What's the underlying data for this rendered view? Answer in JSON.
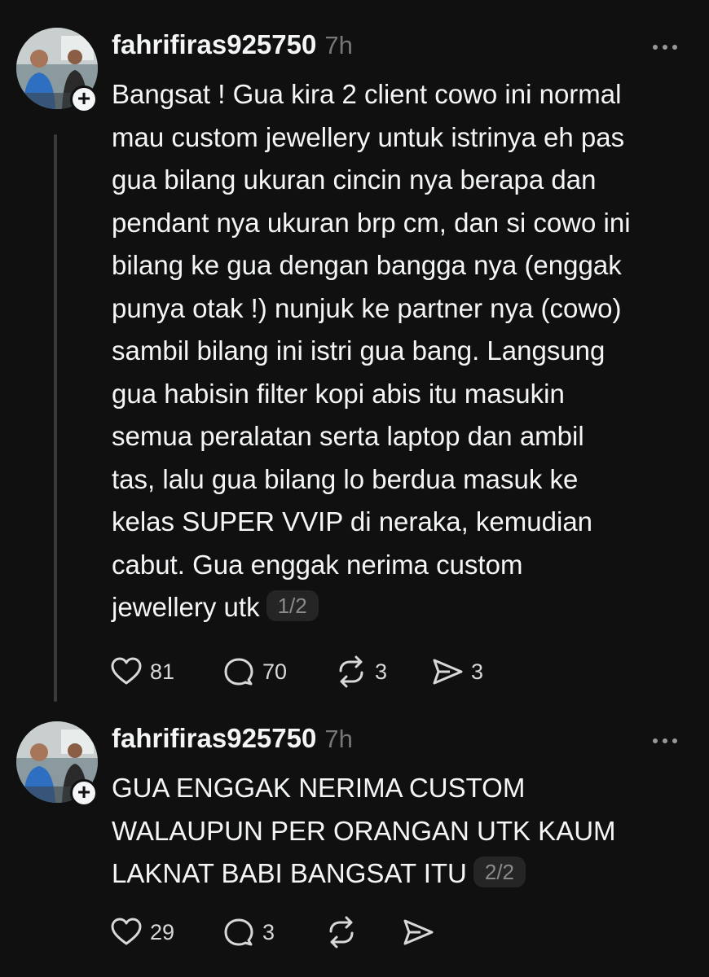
{
  "posts": [
    {
      "username": "fahrifiras925750",
      "time": "7h",
      "lines": [
        "Bangsat ! Gua kira 2 client cowo ini normal",
        "mau custom jewellery untuk istrinya eh pas",
        "gua bilang ukuran cincin nya berapa dan",
        "pendant nya ukuran brp cm, dan si cowo ini",
        "bilang ke gua dengan bangga nya (enggak",
        "punya otak !) nunjuk ke partner nya (cowo)",
        "sambil bilang ini istri gua bang. Langsung",
        "gua habisin filter kopi abis itu masukin",
        "semua peralatan serta laptop dan ambil",
        "tas, lalu gua bilang lo berdua masuk ke",
        "kelas SUPER VVIP di neraka, kemudian",
        "cabut. Gua enggak nerima custom",
        "jewellery utk"
      ],
      "page_indicator": "1/2",
      "likes": "81",
      "replies": "70",
      "reposts": "3",
      "shares": "3",
      "icons": [
        "heart-icon",
        "comment-icon",
        "repost-icon",
        "share-icon",
        "more-icon",
        "follow-plus-icon"
      ]
    },
    {
      "username": "fahrifiras925750",
      "time": "7h",
      "lines": [
        "GUA ENGGAK NERIMA CUSTOM",
        "WALAUPUN PER ORANGAN UTK KAUM",
        "LAKNAT BABI BANGSAT ITU"
      ],
      "page_indicator": "2/2",
      "likes": "29",
      "replies": "3",
      "reposts": "",
      "shares": "",
      "icons": [
        "heart-icon",
        "comment-icon",
        "repost-icon",
        "share-icon",
        "more-icon",
        "follow-plus-icon"
      ]
    }
  ],
  "colors": {
    "background": "#101010",
    "text": "#f3f5f7",
    "muted": "#777777",
    "chip_background": "#252525",
    "thread_line": "#3a3a3a"
  }
}
